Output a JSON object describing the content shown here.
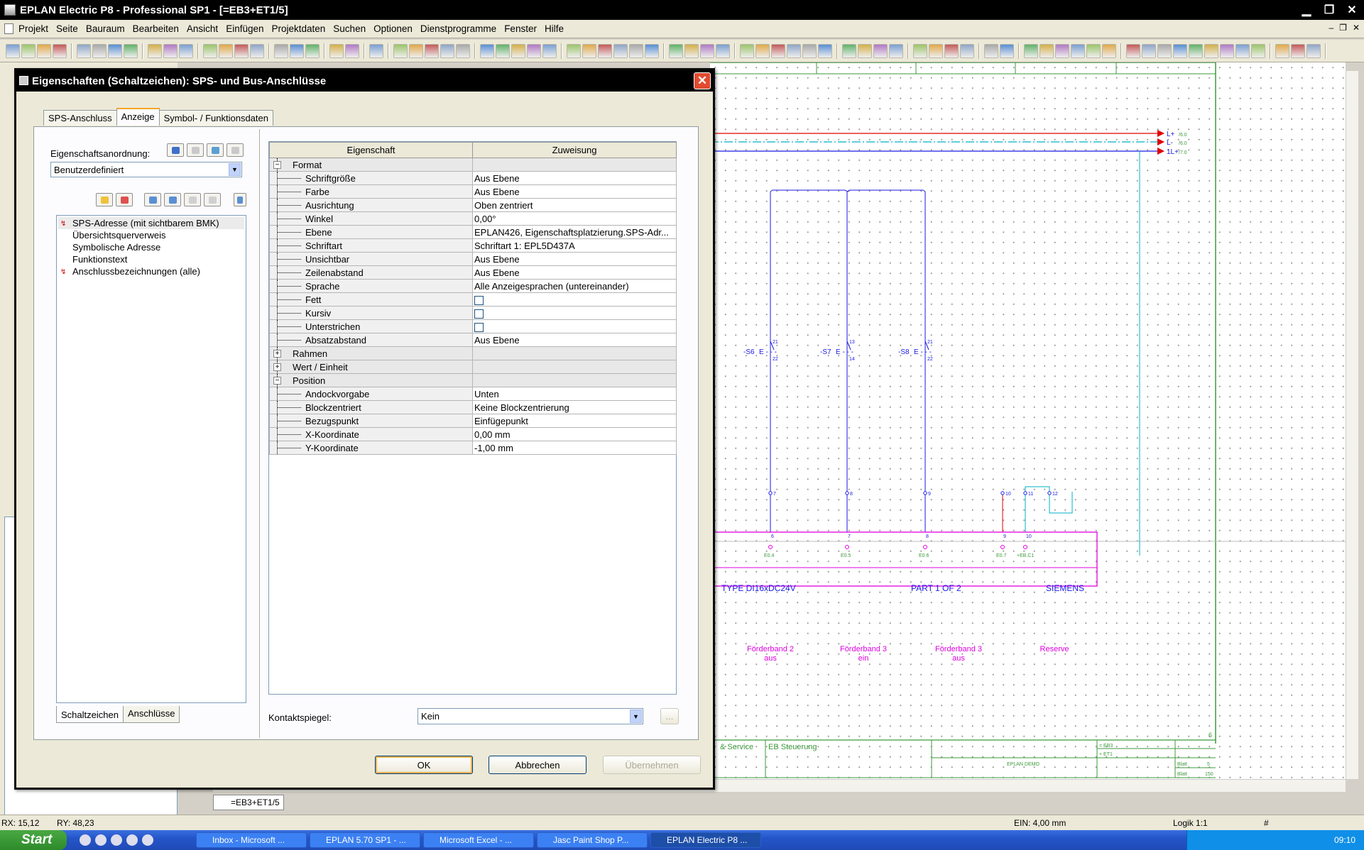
{
  "app": {
    "title": "EPLAN Electric P8 - Professional SP1 - [=EB3+ET1/5]",
    "menu": [
      "Projekt",
      "Seite",
      "Bauraum",
      "Bearbeiten",
      "Ansicht",
      "Einfügen",
      "Projektdaten",
      "Suchen",
      "Optionen",
      "Dienstprogramme",
      "Fenster",
      "Hilfe"
    ],
    "page_tab": "=EB3+ET1/5"
  },
  "dialog": {
    "title": "Eigenschaften (Schaltzeichen): SPS- und Bus-Anschlüsse",
    "tabs": [
      "SPS-Anschluss",
      "Anzeige",
      "Symbol- / Funktionsdaten"
    ],
    "arrangement_label": "Eigenschaftsanordnung:",
    "arrangement_value": "Benutzerdefiniert",
    "tree_items": [
      {
        "label": "SPS-Adresse (mit sichtbarem BMK)",
        "marked": true
      },
      {
        "label": "Übersichtsquerverweis",
        "marked": false
      },
      {
        "label": "Symbolische Adresse",
        "marked": false
      },
      {
        "label": "Funktionstext",
        "marked": false
      },
      {
        "label": "Anschlussbezeichnungen (alle)",
        "marked": true
      }
    ],
    "bottom_tabs": [
      "Schaltzeichen",
      "Anschlüsse"
    ],
    "grid": {
      "col_property": "Eigenschaft",
      "col_value": "Zuweisung",
      "rows": [
        {
          "name": "Format",
          "value": "",
          "group": true,
          "expanded": true
        },
        {
          "name": "Schriftgröße",
          "value": "Aus Ebene"
        },
        {
          "name": "Farbe",
          "value": "Aus Ebene"
        },
        {
          "name": "Ausrichtung",
          "value": "Oben zentriert"
        },
        {
          "name": "Winkel",
          "value": "0,00°"
        },
        {
          "name": "Ebene",
          "value": "EPLAN426, Eigenschaftsplatzierung.SPS-Adr..."
        },
        {
          "name": "Schriftart",
          "value": "Schriftart 1: EPL5D437A"
        },
        {
          "name": "Unsichtbar",
          "value": "Aus Ebene"
        },
        {
          "name": "Zeilenabstand",
          "value": "Aus Ebene"
        },
        {
          "name": "Sprache",
          "value": "Alle Anzeigesprachen (untereinander)"
        },
        {
          "name": "Fett",
          "value": "",
          "checkbox": true
        },
        {
          "name": "Kursiv",
          "value": "",
          "checkbox": true
        },
        {
          "name": "Unterstrichen",
          "value": "",
          "checkbox": true
        },
        {
          "name": "Absatzabstand",
          "value": "Aus Ebene"
        },
        {
          "name": "Rahmen",
          "value": "",
          "group": true,
          "expanded": false
        },
        {
          "name": "Wert / Einheit",
          "value": "",
          "group": true,
          "expanded": false
        },
        {
          "name": "Position",
          "value": "",
          "group": true,
          "expanded": true
        },
        {
          "name": "Andockvorgabe",
          "value": "Unten"
        },
        {
          "name": "Blockzentriert",
          "value": "Keine Blockzentrierung"
        },
        {
          "name": "Bezugspunkt",
          "value": "Einfügepunkt"
        },
        {
          "name": "X-Koordinate",
          "value": "0,00 mm"
        },
        {
          "name": "Y-Koordinate",
          "value": "-1,00 mm"
        }
      ]
    },
    "contact_mirror_label": "Kontaktspiegel:",
    "contact_mirror_value": "Kein",
    "buttons": {
      "ok": "OK",
      "cancel": "Abbrechen",
      "apply": "Übernehmen",
      "more": "..."
    }
  },
  "drawing": {
    "rails": [
      "L+",
      "L-",
      "1L+"
    ],
    "rail_refs": [
      "/6.0",
      "/6.0",
      "/7.0"
    ],
    "switches": [
      "-S6",
      "-S7",
      "-S8"
    ],
    "switch_terms": [
      [
        "21",
        "22"
      ],
      [
        "13",
        "14"
      ],
      [
        "21",
        "22"
      ]
    ],
    "terminals": [
      "7",
      "8",
      "9",
      "10",
      "11",
      "12"
    ],
    "plc_pins": [
      "6",
      "7",
      "8",
      "9",
      "10"
    ],
    "plc_addresses": [
      "E0.4",
      "E0.5",
      "E0.6",
      "E0.7",
      "+EB.C1"
    ],
    "plc_type": "TYPE DI16xDC24V",
    "plc_part": "PART 1 OF 2",
    "plc_vendor": "SIEMENS",
    "functions": [
      [
        "Förderband 2",
        "aus"
      ],
      [
        "Förderband 3",
        "ein"
      ],
      [
        "Förderband 3",
        "aus"
      ],
      [
        "Reserve",
        ""
      ]
    ],
    "titleblock": {
      "company": "& Service",
      "project": "EB Steuerung",
      "demo": "EPLAN DEMO",
      "eq1": "= EB3",
      "eq2": "+ ET1",
      "page": "5",
      "pages": "150",
      "col": "6",
      "sheet_label": "Blatt"
    }
  },
  "status": {
    "rx": "RX: 15,12",
    "ry": "RY: 48,23",
    "grid": "EIN: 4,00 mm",
    "logic": "Logik 1:1",
    "hash": "#"
  },
  "taskbar": {
    "start": "Start",
    "tasks": [
      "Inbox - Microsoft ...",
      "EPLAN 5.70 SP1 - ...",
      "Microsoft Excel - ...",
      "Jasc Paint Shop P...",
      "EPLAN Electric P8 ..."
    ],
    "clock": "09:10"
  },
  "colors": {
    "accent_blue": "#1a1ae6",
    "plc_magenta": "#e000e0",
    "frame_green": "#3c9a3c",
    "rail_cyan": "#00b0c8",
    "rail_red": "#e00000"
  }
}
